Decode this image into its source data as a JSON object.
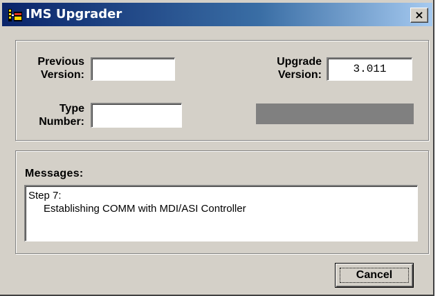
{
  "window": {
    "title": "IMS Upgrader",
    "close_label": "×"
  },
  "version_panel": {
    "previous_version_label_line1": "Previous",
    "previous_version_label_line2": "Version:",
    "previous_version_value": "",
    "upgrade_version_label_line1": "Upgrade",
    "upgrade_version_label_line2": "Version:",
    "upgrade_version_value": "3.011",
    "type_number_label_line1": "Type",
    "type_number_label_line2": "Number:",
    "type_number_value": "",
    "progress_fraction": 0
  },
  "messages": {
    "label": "Messages:",
    "lines": [
      "Step 7:",
      "Establishing COMM with MDI/ASI Controller"
    ]
  },
  "actions": {
    "cancel_label": "Cancel"
  },
  "colors": {
    "titlebar_start": "#0a246a",
    "titlebar_end": "#a6caf0",
    "face": "#d4d0c8",
    "progress_track": "#808080"
  }
}
